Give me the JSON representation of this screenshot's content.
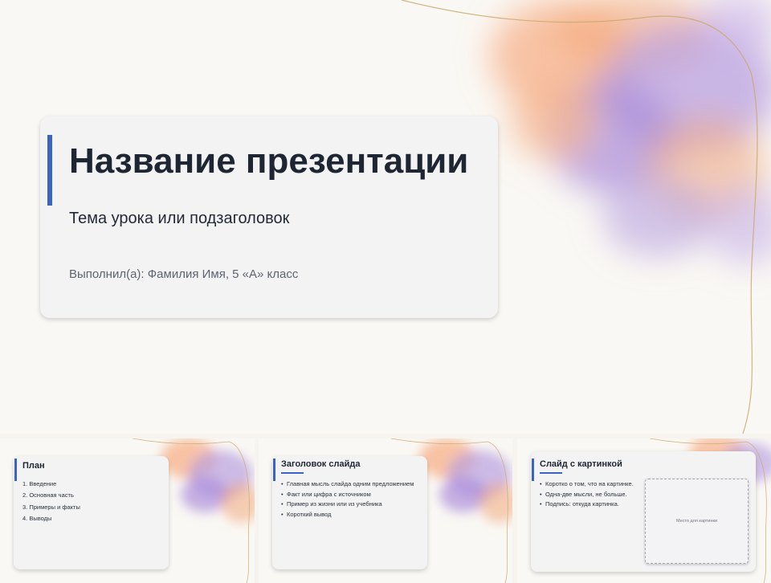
{
  "main_slide": {
    "title": "Название презентации",
    "subtitle": "Тема урока или подзаголовок",
    "author": "Выполнил(а): Фамилия Имя, 5 «А» класс"
  },
  "thumbnails": [
    {
      "title": "План",
      "items": [
        "1. Введение",
        "2. Основная часть",
        "3. Примеры и факты",
        "4. Выводы"
      ]
    },
    {
      "title": "Заголовок слайда",
      "items": [
        "Главная мысль слайда одним предложением",
        "Факт или цифра с источником",
        "Пример из жизни или из учебника",
        "Короткий вывод"
      ]
    },
    {
      "title": "Слайд с картинкой",
      "items": [
        "Коротко о том, что на картинке.",
        "Одна-две мысли, не больше.",
        "Подпись: откуда картинка."
      ],
      "image_placeholder": "Место для картинки"
    }
  ],
  "colors": {
    "accent": "#3b63c4",
    "background": "#faf8f4",
    "card": "#f3f3f4",
    "title_text": "#1e2533"
  }
}
